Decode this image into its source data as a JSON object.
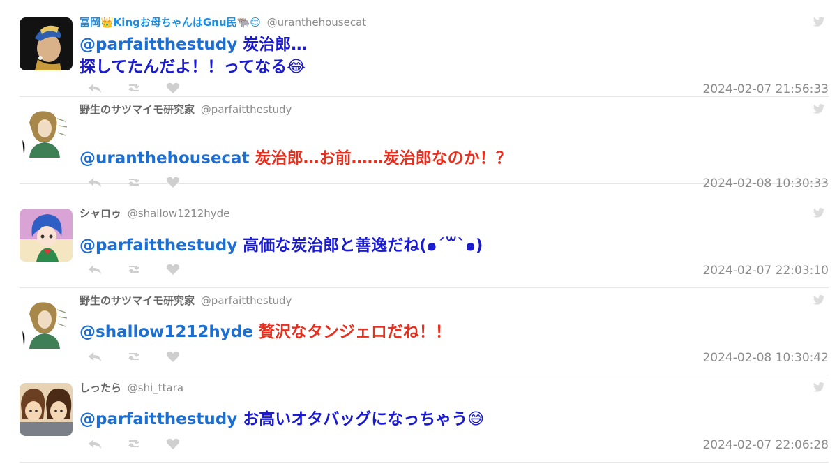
{
  "tweets": [
    {
      "display_name": "冨岡👑Kingお母ちゃんはGnu民🐃😊",
      "handle": "@uranthehousecat",
      "mention": "@parfaitthestudy",
      "text_line1": " 炭治郎…",
      "text_line2": "探してたんだよ！！ってなる😂",
      "timestamp": "2024-02-07 21:56:33",
      "avatar": "pearl-earring-portrait"
    },
    {
      "display_name": "野生のサツマイモ研究家",
      "handle": "@parfaitthestudy",
      "mention": "@uranthehousecat",
      "text_line1": " 炭治郎…お前……炭治郎なのか！？",
      "timestamp": "2024-02-08 10:30:33",
      "avatar": "sketch-portrait"
    },
    {
      "display_name": "シャロゥ",
      "handle": "@shallow1212hyde",
      "mention": "@parfaitthestudy",
      "text_line1": " 高価な炭治郎と善逸だね(๑´꒳`๑)",
      "timestamp": "2024-02-07 22:03:10",
      "avatar": "anime-blue-hair"
    },
    {
      "display_name": "野生のサツマイモ研究家",
      "handle": "@parfaitthestudy",
      "mention": "@shallow1212hyde",
      "text_line1": " 贅沢なタンジェロだね！！",
      "timestamp": "2024-02-08 10:30:42",
      "avatar": "sketch-portrait"
    },
    {
      "display_name": "しったら",
      "handle": "@shi_ttara",
      "mention": "@parfaitthestudy",
      "text_line1": " お高いオタバッグになっちゃう😅",
      "timestamp": "2024-02-07 22:06:28",
      "avatar": "two-friends-cartoon"
    }
  ],
  "icons": {
    "reply": "reply-icon",
    "retweet": "retweet-icon",
    "like": "heart-icon",
    "source": "twitter-bird-icon"
  },
  "colors": {
    "blue_text": "#1a1ad0",
    "mention": "#1c6ed0",
    "red_text": "#e5301f",
    "linked_name": "#1d8fe3",
    "muted": "#8c8c8c"
  }
}
